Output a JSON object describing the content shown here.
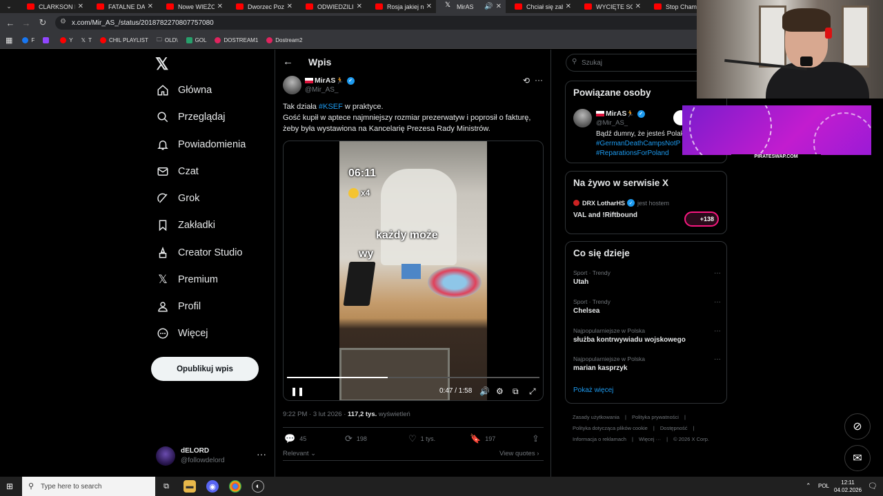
{
  "browser": {
    "tabs": [
      {
        "title": "CLARKSON I P",
        "favicon": "youtube-icon",
        "active": false
      },
      {
        "title": "FATALNE DANE",
        "favicon": "youtube-icon",
        "active": false
      },
      {
        "title": "Nowe WIEŻOW",
        "favicon": "youtube-icon",
        "active": false
      },
      {
        "title": "Dworzec Pozn",
        "favicon": "youtube-icon",
        "active": false
      },
      {
        "title": "ODWIEDZILIŚM",
        "favicon": "youtube-icon",
        "active": false
      },
      {
        "title": "Rosja jakiej nie",
        "favicon": "youtube-icon",
        "active": false
      },
      {
        "title": "MirAS",
        "favicon": "x-icon",
        "active": true
      },
      {
        "title": "Chciał się zaba",
        "favicon": "youtube-icon",
        "active": false
      },
      {
        "title": "WYCIĘTE SCEN",
        "favicon": "youtube-icon",
        "active": false
      },
      {
        "title": "Stop Cham #1",
        "favicon": "youtube-icon",
        "active": false
      }
    ],
    "url": "x.com/Mir_AS_/status/2018782270807757080",
    "bookmarks": [
      "F",
      "",
      "Y",
      "T",
      "CHIL PLAYLIST",
      "OLD\\",
      "GOL",
      "DOSTREAM1",
      "Dostream2"
    ]
  },
  "sidebar": {
    "nav": [
      {
        "label": "Główna",
        "icon": "home-icon"
      },
      {
        "label": "Przeglądaj",
        "icon": "search-icon"
      },
      {
        "label": "Powiadomienia",
        "icon": "bell-icon"
      },
      {
        "label": "Czat",
        "icon": "mail-icon"
      },
      {
        "label": "Grok",
        "icon": "grok-icon"
      },
      {
        "label": "Zakładki",
        "icon": "bookmark-icon"
      },
      {
        "label": "Creator Studio",
        "icon": "creator-icon"
      },
      {
        "label": "Premium",
        "icon": "x-icon"
      },
      {
        "label": "Profil",
        "icon": "person-icon"
      },
      {
        "label": "Więcej",
        "icon": "more-circle-icon"
      }
    ],
    "post_button": "Opublikuj wpis",
    "account": {
      "name": "dELORD",
      "handle": "@followdelord"
    }
  },
  "main": {
    "header": "Wpis",
    "author": {
      "name": "MirAS",
      "handle": "@Mir_AS_"
    },
    "text_prefix": "Tak działa ",
    "hashtag": "#KSEF",
    "text_suffix": " w praktyce.",
    "text_body": "Gość kupił w aptece najmniejszy rozmiar prezerwatyw i poprosił o fakturę, żeby była wystawiona na Kancelarię Prezesa Rady Ministrów.",
    "video": {
      "overlay_time": "06:11",
      "overlay_count": "x4",
      "caption": "każdy może",
      "caption2": "wy",
      "time": "0:47 / 1:58",
      "progress_fraction": 0.4
    },
    "meta_time": "9:22 PM · 3 lut 2026 · ",
    "meta_views": "117,2 tys.",
    "meta_views_label": " wyświetleń",
    "actions": {
      "replies": "45",
      "reposts": "198",
      "likes": "1 tys.",
      "bookmarks": "197"
    },
    "relevant": "Relevant",
    "view_quotes": "View quotes"
  },
  "right": {
    "search_placeholder": "Szukaj",
    "related_title": "Powiązane osoby",
    "related": {
      "name": "MirAS",
      "handle": "@Mir_AS_",
      "bio": "Bądź dumny, że jesteś Polak",
      "bio_tag1": "#GermanDeathCampsNotP",
      "bio_tag2": "#ReparationsForPoland"
    },
    "live_title": "Na żywo w serwisie X",
    "live_host": "DRX LotharHS",
    "live_host_suffix": "jest hostem",
    "live_space": "VAL and !Riftbound",
    "live_count": "+138",
    "trends_title": "Co się dzieje",
    "trends": [
      {
        "category": "Sport · Trendy",
        "name": "Utah"
      },
      {
        "category": "Sport · Trendy",
        "name": "Chelsea"
      },
      {
        "category": "Najpopularniejsze w Polska",
        "name": "służba kontrwywiadu wojskowego"
      },
      {
        "category": "Najpopularniejsze w Polska",
        "name": "marian kasprzyk"
      }
    ],
    "show_more": "Pokaż więcej",
    "footer": [
      "Zasady użytkowania",
      "Polityka prywatności",
      "Polityka dotycząca plików cookie",
      "Dostępność",
      "Informacja o reklamach",
      "Więcej ···",
      "© 2026 X Corp."
    ]
  },
  "overlay": {
    "ad_label": "PIRATESWAP.COM"
  },
  "taskbar": {
    "search_placeholder": "Type here to search",
    "lang": "POL",
    "time": "12:11",
    "date": "04.02.2026"
  }
}
